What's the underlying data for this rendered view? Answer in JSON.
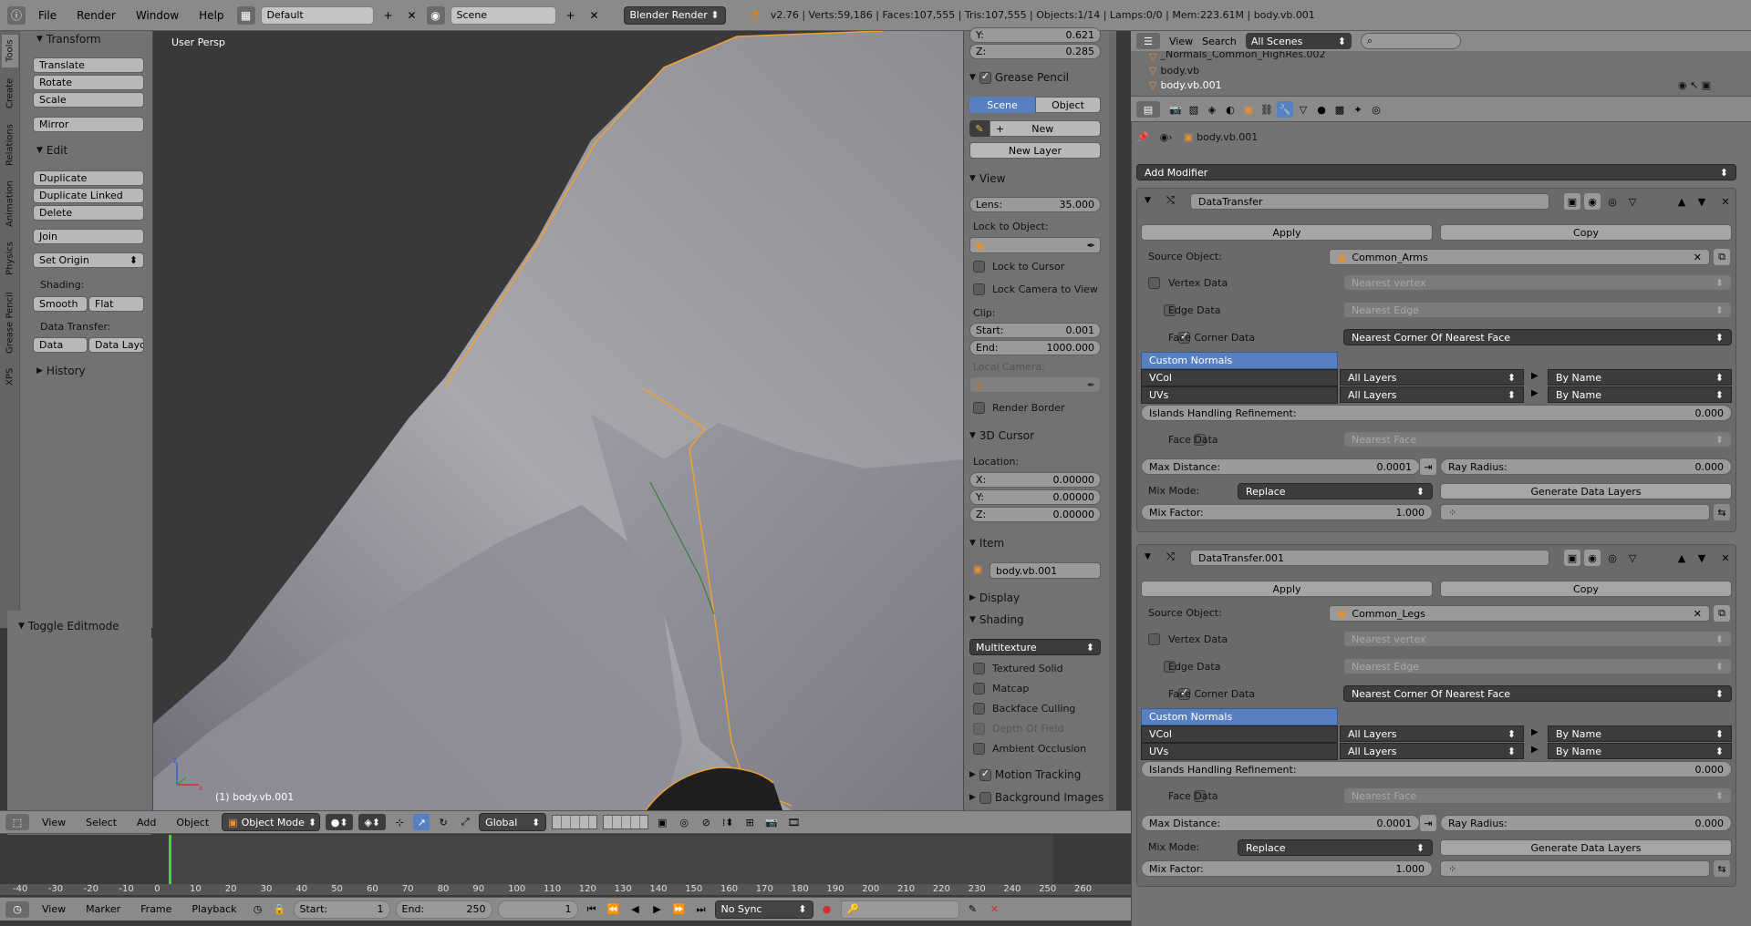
{
  "topbar": {
    "menus": [
      "File",
      "Render",
      "Window",
      "Help"
    ],
    "layout": "Default",
    "scene": "Scene",
    "engine": "Blender Render",
    "stats": "v2.76 | Verts:59,186 | Faces:107,555 | Tris:107,555 | Objects:1/14 | Lamps:0/0 | Mem:223.61M | body.vb.001"
  },
  "tools": {
    "tabs": [
      "Tools",
      "Create",
      "Relations",
      "Animation",
      "Physics",
      "Grease Pencil",
      "XPS"
    ],
    "transform_title": "Transform",
    "translate": "Translate",
    "rotate": "Rotate",
    "scale": "Scale",
    "mirror": "Mirror",
    "edit_title": "Edit",
    "duplicate": "Duplicate",
    "duplicate_linked": "Duplicate Linked",
    "delete": "Delete",
    "join": "Join",
    "set_origin": "Set Origin",
    "shading_label": "Shading:",
    "smooth": "Smooth",
    "flat": "Flat",
    "data_transfer_label": "Data Transfer:",
    "data": "Data",
    "data_layout": "Data Layo",
    "history_title": "History",
    "toggle_editmode": "Toggle Editmode"
  },
  "viewport": {
    "persp": "User Persp",
    "object_label": "(1) body.vb.001",
    "menus": [
      "View",
      "Select",
      "Add",
      "Object"
    ],
    "mode": "Object Mode",
    "orientation": "Global"
  },
  "npanel": {
    "y_label": "Y:",
    "y_value": "0.621",
    "z_label": "Z:",
    "z_value": "0.285",
    "grease_title": "Grease Pencil",
    "tab_scene": "Scene",
    "tab_object": "Object",
    "new": "New",
    "new_layer": "New Layer",
    "view_title": "View",
    "lens_label": "Lens:",
    "lens_value": "35.000",
    "lock_to_object": "Lock to Object:",
    "lock_to_cursor": "Lock to Cursor",
    "lock_camera": "Lock Camera to View",
    "clip_label": "Clip:",
    "start_label": "Start:",
    "start_value": "0.001",
    "end_label": "End:",
    "end_value": "1000.000",
    "local_camera": "Local Camera:",
    "render_border": "Render Border",
    "cursor_title": "3D Cursor",
    "location_label": "Location:",
    "cx_label": "X:",
    "cx_value": "0.00000",
    "cy_label": "Y:",
    "cy_value": "0.00000",
    "cz_label": "Z:",
    "cz_value": "0.00000",
    "item_title": "Item",
    "item_name": "body.vb.001",
    "display_title": "Display",
    "shading_title": "Shading",
    "shading_mode": "Multitexture",
    "textured_solid": "Textured Solid",
    "matcap": "Matcap",
    "backface": "Backface Culling",
    "dof": "Depth Of Field",
    "ao": "Ambient Occlusion",
    "motion_tracking": "Motion Tracking",
    "background_images": "Background Images"
  },
  "outliner": {
    "menus": [
      "View",
      "Search"
    ],
    "scenes": "All Scenes",
    "items": [
      "_Normals_Common_HighRes.002",
      "body.vb",
      "body.vb.001"
    ]
  },
  "properties": {
    "object": "body.vb.001",
    "add_modifier": "Add Modifier",
    "modifiers": [
      {
        "name": "DataTransfer",
        "apply": "Apply",
        "copy": "Copy",
        "source_label": "Source Object:",
        "source": "Common_Arms",
        "vertex_data": "Vertex Data",
        "vertex_mode": "Nearest vertex",
        "edge_data": "Edge Data",
        "edge_mode": "Nearest Edge",
        "face_corner": "Face Corner Data",
        "face_corner_mode": "Nearest Corner Of Nearest Face",
        "custom_normals": "Custom Normals",
        "vcol": "VCol",
        "vcol_layers": "All Layers",
        "vcol_by": "By Name",
        "uvs": "UVs",
        "uvs_layers": "All Layers",
        "uvs_by": "By Name",
        "islands_label": "Islands Handling Refinement:",
        "islands_value": "0.000",
        "face_data": "Face Data",
        "face_mode": "Nearest Face",
        "max_dist_label": "Max Distance:",
        "max_dist": "0.0001",
        "ray_label": "Ray Radius:",
        "ray_value": "0.000",
        "mix_mode_label": "Mix Mode:",
        "mix_mode": "Replace",
        "generate": "Generate Data Layers",
        "mix_factor_label": "Mix Factor:",
        "mix_factor": "1.000"
      },
      {
        "name": "DataTransfer.001",
        "apply": "Apply",
        "copy": "Copy",
        "source_label": "Source Object:",
        "source": "Common_Legs",
        "vertex_data": "Vertex Data",
        "vertex_mode": "Nearest vertex",
        "edge_data": "Edge Data",
        "edge_mode": "Nearest Edge",
        "face_corner": "Face Corner Data",
        "face_corner_mode": "Nearest Corner Of Nearest Face",
        "custom_normals": "Custom Normals",
        "vcol": "VCol",
        "vcol_layers": "All Layers",
        "vcol_by": "By Name",
        "uvs": "UVs",
        "uvs_layers": "All Layers",
        "uvs_by": "By Name",
        "islands_label": "Islands Handling Refinement:",
        "islands_value": "0.000",
        "face_data": "Face Data",
        "face_mode": "Nearest Face",
        "max_dist_label": "Max Distance:",
        "max_dist": "0.0001",
        "ray_label": "Ray Radius:",
        "ray_value": "0.000",
        "mix_mode_label": "Mix Mode:",
        "mix_mode": "Replace",
        "generate": "Generate Data Layers",
        "mix_factor_label": "Mix Factor:",
        "mix_factor": "1.000"
      }
    ]
  },
  "timeline": {
    "ticks": [
      "-40",
      "-30",
      "-20",
      "-10",
      "0",
      "10",
      "20",
      "30",
      "40",
      "50",
      "60",
      "70",
      "80",
      "90",
      "100",
      "110",
      "120",
      "130",
      "140",
      "150",
      "160",
      "170",
      "180",
      "190",
      "200",
      "210",
      "220",
      "230",
      "240",
      "250",
      "260"
    ],
    "current_frame_value": 0,
    "menus": [
      "View",
      "Marker",
      "Frame",
      "Playback"
    ],
    "start_label": "Start:",
    "start": "1",
    "end_label": "End:",
    "end": "250",
    "current": "1",
    "sync": "No Sync"
  },
  "colors": {
    "accent": "#5680c2",
    "selection_outline": "#f0a030",
    "frame_marker": "#55cc33"
  }
}
